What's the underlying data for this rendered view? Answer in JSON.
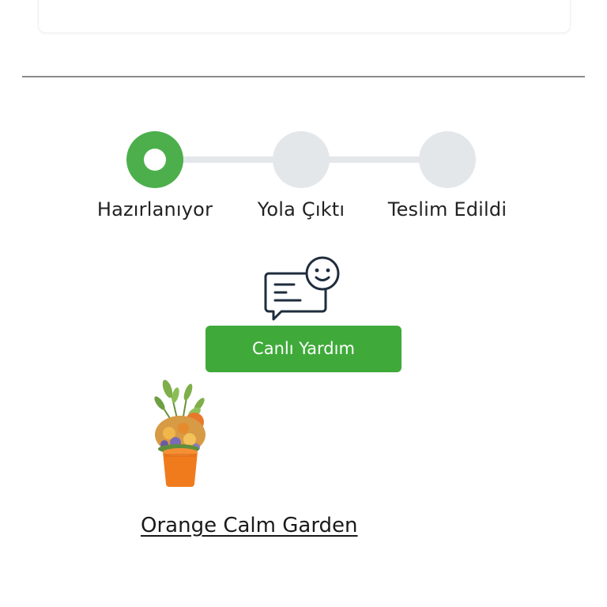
{
  "tracker": {
    "steps": [
      {
        "label": "Hazırlanıyor",
        "status": "active"
      },
      {
        "label": "Yola Çıktı",
        "status": "pending"
      },
      {
        "label": "Teslim Edildi",
        "status": "pending"
      }
    ],
    "active_color": "#4caf4c",
    "inactive_color": "#e4e7ea"
  },
  "support": {
    "icon": "chat-smiley-icon",
    "button_label": "Canlı Yardım",
    "button_color": "#3faa3a"
  },
  "product": {
    "name": "Orange Calm Garden",
    "image_icon": "orange-flower-pot-image"
  }
}
